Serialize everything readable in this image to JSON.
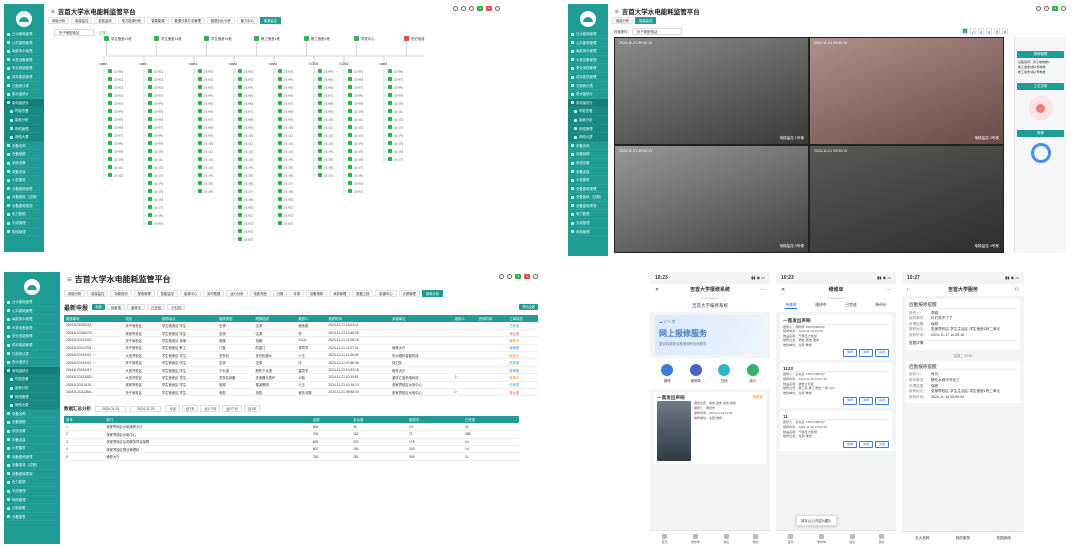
{
  "app_title": "吉首大学水电能耗监管平台",
  "colors": {
    "primary": "#1f9c94",
    "node": "#33b24a",
    "alarm": "#e54d42"
  },
  "sidebar_items": [
    "日水能耗管理",
    "公共能耗管理",
    "每能用水管理",
    "水表设备管理",
    "采业用能管理",
    "成本能能管理",
    "日能统计表",
    "用水量统计",
    "用电量统计",
    "时能查看",
    "能耗分析",
    "网络管理",
    "网络大屏",
    "设备名称",
    "设备缺额",
    "系统设置",
    "设备连接",
    "小型建筑",
    "设备能耗管理",
    "设备能耗（过期）",
    "设备能耗预测",
    "电力数据",
    "天线管理",
    "网络管理",
    "日能超限",
    "设备报表",
    "报修管理",
    "日能统计"
  ],
  "tl": {
    "tabs": [
      "用能分析",
      "能量监控",
      "复能监测",
      "电力能源分析",
      "智能能源",
      "数据分析汇总管理",
      "数据对比分析",
      "能力中心",
      "能源监控"
    ],
    "filter_label": "折子坡配电站",
    "filter_value": "正常",
    "bus_labels": [
      "cam1",
      "cam1",
      "cam1",
      "cam2",
      "cam2",
      "COM1",
      "COM2",
      "cam3"
    ],
    "top_nodes": [
      "学生宿舍13栋",
      "学生宿舍14栋",
      "学生宿舍15栋",
      "教工宿舍1栋",
      "教工宿舍2栋",
      "学校中心",
      "历史电费"
    ],
    "meter_ids": [
      "21-001",
      "21-012",
      "21-013",
      "21-021",
      "21-031",
      "21-041",
      "21-051",
      "21-061",
      "21-071",
      "21-081",
      "21-091",
      "21-101",
      "21-111",
      "21-121",
      "21-131",
      "21-141",
      "21-151",
      "21-161",
      "21-171",
      "21-181"
    ]
  },
  "tr": {
    "tabs": [
      "用能分析",
      "能量监控"
    ],
    "search_label": "检索条件：",
    "search_value": "折子坡配电站",
    "pagination": [
      "1",
      "2",
      "3",
      "4",
      "5",
      "6"
    ],
    "cams": [
      {
        "label": "电梯监控 1号梯",
        "time": "2024-11-21 09:00:12"
      },
      {
        "label": "电梯监控 2号梯",
        "time": "2024-11-21 09:00:14"
      },
      {
        "label": "电梯监控 3号梯",
        "time": "2024-11-21 09:00:13"
      },
      {
        "label": "电梯监控 4号梯",
        "time": "2024-11-21 09:00:15"
      },
      {
        "label": "电梯监控 5号梯",
        "time": "2024-11-21 09:00:11"
      },
      {
        "label": "电梯监控 6号梯",
        "time": "2024-11-21 09:00:10"
      }
    ],
    "right_panels": [
      "报修管理",
      "工位控制",
      "报修"
    ],
    "right_list": [
      "设备名称：折子坡电梯1",
      "教工宿舍5栋2号电梯",
      "教工宿舍4栋1号电梯"
    ]
  },
  "bl": {
    "tabs": [
      "用能分析",
      "能量监控",
      "功能检测",
      "配电管理",
      "智能监控",
      "能源中心",
      "实时数据",
      "运行分析",
      "电费充值",
      "日报",
      "月报",
      "设备报修",
      "消费管理",
      "数据上报",
      "能源中心",
      "大屏管理",
      "用电分析"
    ],
    "section_title": "最新申报",
    "filter_tabs": [
      "全部",
      "待审核",
      "维修中",
      "已完成",
      "已归档"
    ],
    "export_label": "导出全部",
    "columns": [
      "报修单号",
      "校区",
      "故障地点",
      "故障类型",
      "故障描述",
      "报修人",
      "报修时间",
      "承接单位",
      "维修人",
      "完成时间",
      "工单状态"
    ],
    "rows": [
      [
        "20241121093113...",
        "折子坡校区",
        "学生宿舍区·学生...",
        "空调",
        "空调",
        "宿舍楼",
        "2024-11-21 15:03:11",
        "",
        "",
        "",
        "已完成"
      ],
      [
        "20241120145279...",
        "张家界校区",
        "学生宿舍区·学生...",
        "空调",
        "空调",
        "学",
        "2024-11-21 12:45:28",
        "",
        "",
        "",
        "待派遣"
      ],
      [
        "20241120131000...",
        "折子坡校区",
        "学生宿舍区·张家...",
        "电梯",
        "电梯",
        "11111",
        "2024-11-21 12:08:18",
        "",
        "",
        "",
        "维修中"
      ],
      [
        "20241120110709...",
        "折子坡校区",
        "学生宿舍区·教工...",
        "门窗",
        "防盗门",
        "李同学",
        "2024-11-21 12:07:31",
        "维修大厅",
        "",
        "",
        "待审核"
      ],
      [
        "20241120134417...",
        "大田湾校区",
        "学生宿舍区·学生...",
        "洗衣机",
        "洗衣机漏水",
        "小王",
        "2024-11-21 11:36:42",
        "杭州维科智能科技...",
        "",
        "",
        "维修中"
      ],
      [
        "20241120134417...",
        "折子坡校区",
        "学生宿舍区·学生...",
        "空调",
        "空调",
        "冷",
        "2024-11-21 10:36:36",
        "保卫处",
        "",
        "",
        "已完成"
      ],
      [
        "20241120134417...",
        "大田湾校区",
        "学生宿舍区·学生...",
        "下水道",
        "厕所下水道",
        "雷同学",
        "2024-11-21 10:33:18",
        "维修大厅",
        "",
        "",
        "待审核"
      ],
      [
        "20241120131830...",
        "大田湾校区",
        "学生宿舍区·学生...",
        "洗衣机设备",
        "洗涤器头损坏",
        "卢新",
        "2024-11-21 10:19:51",
        "重庆汇度机电科技...",
        "2",
        "",
        "维修中"
      ],
      [
        "20241120110120...",
        "张家界校区",
        "学生宿舍区·学生...",
        "电梯",
        "楼道照明",
        "小王",
        "2024-11-21 10:16:13",
        "张家界校区水电中心",
        "",
        "",
        "已完成"
      ],
      [
        "20241121111368...",
        "折子坡校区",
        "学生宿舍区·学生...",
        "电视",
        "电视",
        "租赁问题",
        "2024-11-21 09:58:03",
        "张家界校区水电中心",
        "0",
        "",
        "待派遣"
      ]
    ],
    "stats_title": "数据汇总分析",
    "date_from": "2024-01-01",
    "date_to": "2024-11-20",
    "range_buttons": [
      "今天",
      "近7天",
      "近1个月",
      "近3个月",
      "近1年"
    ],
    "stat_columns": [
      "序号",
      "部门",
      "全部",
      "未派遣",
      "维修中",
      "已完成"
    ],
    "stats": [
      [
        "1",
        "张家界校区水电维修大厅",
        "506",
        "39",
        "14",
        "20"
      ],
      [
        "2",
        "张家界校区水电中心",
        "709",
        "118",
        "71",
        "488"
      ],
      [
        "3",
        "张家界校区后勤服务项目保障",
        "605",
        "230",
        "178",
        "14"
      ],
      [
        "4",
        "张家界校区物业管理科",
        "602",
        "194",
        "200",
        "14"
      ],
      [
        "5",
        "维修大厅",
        "750",
        "281",
        "309",
        "11"
      ]
    ]
  },
  "br": {
    "phone1": {
      "time": "10:23",
      "title": "吉首大学报修系统",
      "url": "m.jsu.edu.cn",
      "brand": "吉首大学报修系统",
      "weather": "17°C",
      "weather_place": "雾",
      "banner_title": "网上报修服务",
      "banner_sub": "整合和更新流程便拥有优质服务",
      "actions": [
        "报修",
        "维修单",
        "扫码",
        "统计"
      ],
      "latest_title": "一直发出声响",
      "latest_status": "待维修",
      "latest_lines": [
        "报修位置：宿舍-宿舍-宿舍-宿舍",
        "报修人：傅同学",
        "报修时间：2024-11-19 10:35",
        "维修单位：全部-维修"
      ],
      "tabbar": [
        "首页",
        "维修单",
        "消息",
        "我的"
      ]
    },
    "phone2": {
      "time": "10:23",
      "title": "维修单",
      "url": "m.jsu.edu.cn",
      "tabs": [
        "待维修",
        "维修中",
        "已完成",
        "待评价"
      ],
      "cards": [
        {
          "title": "一直发出声响",
          "lines": [
            "报修人：傅同学 15676589300",
            "报修时间：2024-11-19 10:35",
            "物品名称：气体压力检测",
            "报修位置：宿舍-宿舍-宿舍",
            "维修单位：全部-维修"
          ]
        },
        {
          "title": "1123",
          "lines": [
            "报修人：彭先生 13574058790",
            "报修时间：2024-11-20 10:57:26",
            "物品名称：宿舍公共区",
            "报修位置：教工区-教工宿舍-一栋-101",
            "维修单位：全部-维修"
          ]
        },
        {
          "title": "11",
          "lines": [
            "报修人：彭先生 13574058790",
            "报修时间：2024-11-20 10:51:09",
            "物品名称：气体压力检测",
            "报修位置：全部-维修"
          ]
        }
      ],
      "card_buttons": [
        "催单",
        "派单",
        "完成"
      ],
      "toast": "保存以上内容为图片",
      "tabbar": [
        "首页",
        "维修单",
        "消息",
        "我的"
      ]
    },
    "phone3": {
      "time": "10:27",
      "title": "吉首大学服务",
      "cards": [
        {
          "title": "后勤报修提醒",
          "rows": [
            [
              "报修人：",
              "李鸥"
            ],
            [
              "报修事项：",
              "灯灯亮不了了"
            ],
            [
              "处理结果：",
              "保修"
            ],
            [
              "报修地址：",
              "张家界校区-学生生活区-学生宿舍1栋二单元"
            ],
            [
              "报修时间：",
              "2024-11-17 10:35:16"
            ]
          ],
          "more": "查看详情"
        },
        {
          "title": "后勤报修提醒",
          "rows": [
            [
              "报修人：",
              "肖月"
            ],
            [
              "报修事项：",
              "猪在水阀冷开龙了"
            ],
            [
              "处理结果：",
              "保修"
            ],
            [
              "报修地址：",
              "张家界校区-学生生活区-学生宿舍1栋二单元"
            ],
            [
              "报修时间：",
              "2024-11-19 09:59:04"
            ]
          ],
          "more": ""
        }
      ],
      "date_sep": "星期二 09:59",
      "footer": [
        "吉大官网",
        "我的服务",
        "校园网络"
      ]
    }
  }
}
